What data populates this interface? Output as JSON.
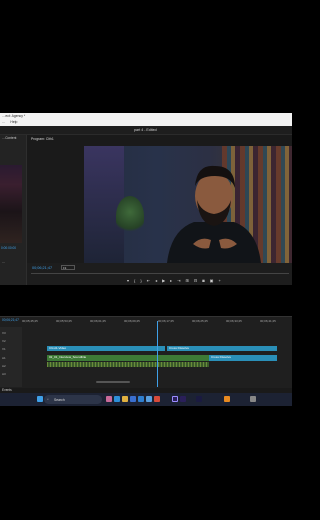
{
  "window": {
    "menu_title": "…ect: Agency *",
    "menu_items": [
      "…",
      "Help"
    ],
    "project_title": "part 4 - Edited"
  },
  "left_panel": {
    "label": "…Content",
    "timecode": "0:00:00:00",
    "bottom_text": "…"
  },
  "program_monitor": {
    "label": "Program: Clth1",
    "timecode": "00;06;21;47",
    "fit": "Fit",
    "transport_icons": [
      "marker-icon",
      "in-point-icon",
      "out-point-icon",
      "go-to-in-icon",
      "step-back-icon",
      "play-icon",
      "step-forward-icon",
      "go-to-out-icon",
      "lift-icon",
      "extract-icon",
      "export-frame-icon",
      "comparison-icon",
      "settings-icon"
    ]
  },
  "timeline": {
    "timecode": "00;06;21;47",
    "ruler_labels": [
      "00;05;45;25",
      "00;05;53;25",
      "00;06;01;25",
      "00;06;09;25",
      "00;06;17;25",
      "00;06;25;25",
      "00;06;33;25",
      "00;06;41;25"
    ],
    "track_labels": [
      "V3",
      "V2",
      "V1",
      "A1",
      "A2",
      "A3"
    ],
    "clips": {
      "v1_a": "Clt-H1-Video",
      "v1_b": "Cross Dissolve",
      "a1_a": "02_01_Interview_Soundbite",
      "a1_b": "Cross Dissolve"
    }
  },
  "statusbar": {
    "text": "Events"
  },
  "taskbar": {
    "search_placeholder": "Search",
    "pinned": [
      "windows-icon",
      "task-view-icon",
      "edge-icon",
      "file-explorer-icon",
      "store-icon",
      "mail-icon",
      "photos-icon",
      "chrome-icon",
      "premiere-icon",
      "media-encoder-icon",
      "after-effects-icon",
      "vlc-icon",
      "settings-icon"
    ]
  }
}
